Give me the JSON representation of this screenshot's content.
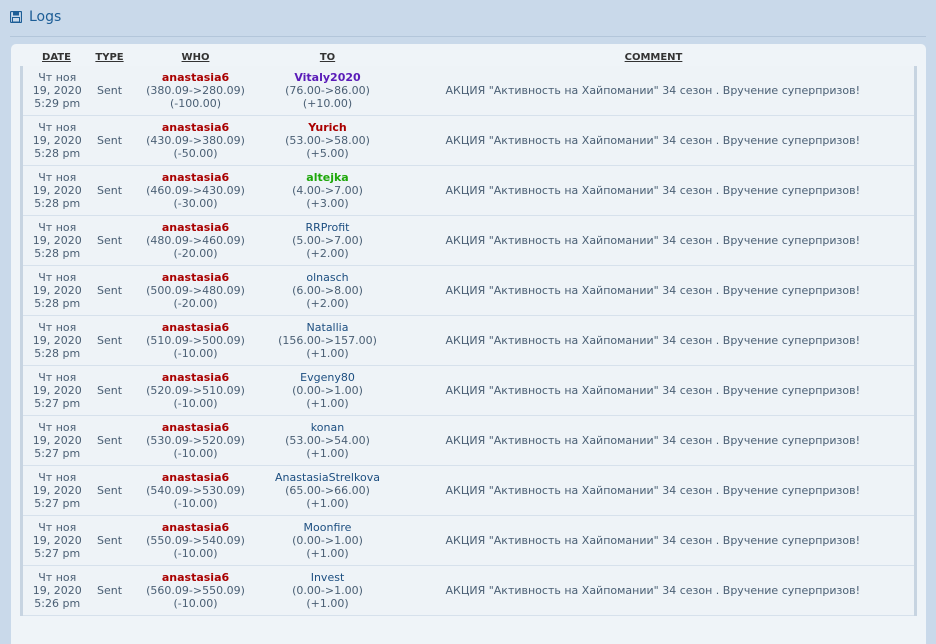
{
  "header": {
    "title": "Logs",
    "icon": "save-icon"
  },
  "table": {
    "columns": {
      "date": "DATE",
      "type": "TYPE",
      "who": "WHO",
      "to": "TO",
      "comment": "COMMENT"
    },
    "rows": [
      {
        "date1": "Чт ноя",
        "date2": "19, 2020",
        "date3": "5:29 pm",
        "type": "Sent",
        "who": "anastasia6",
        "who_balance": "(380.09->280.09)",
        "who_delta": "(-100.00)",
        "to": "Vitaly2020",
        "to_color": "#5a1bb8",
        "to_bold": true,
        "to_balance": "(76.00->86.00)",
        "to_delta": "(+10.00)",
        "comment": "АКЦИЯ \"Активность на Хайпомании\" 34 сезон . Вручение суперпризов!"
      },
      {
        "date1": "Чт ноя",
        "date2": "19, 2020",
        "date3": "5:28 pm",
        "type": "Sent",
        "who": "anastasia6",
        "who_balance": "(430.09->380.09)",
        "who_delta": "(-50.00)",
        "to": "Yurich",
        "to_color": "#aa0000",
        "to_bold": true,
        "to_balance": "(53.00->58.00)",
        "to_delta": "(+5.00)",
        "comment": "АКЦИЯ \"Активность на Хайпомании\" 34 сезон . Вручение суперпризов!"
      },
      {
        "date1": "Чт ноя",
        "date2": "19, 2020",
        "date3": "5:28 pm",
        "type": "Sent",
        "who": "anastasia6",
        "who_balance": "(460.09->430.09)",
        "who_delta": "(-30.00)",
        "to": "altejka",
        "to_color": "#1ea80a",
        "to_bold": true,
        "to_balance": "(4.00->7.00)",
        "to_delta": "(+3.00)",
        "comment": "АКЦИЯ \"Активность на Хайпомании\" 34 сезон . Вручение суперпризов!"
      },
      {
        "date1": "Чт ноя",
        "date2": "19, 2020",
        "date3": "5:28 pm",
        "type": "Sent",
        "who": "anastasia6",
        "who_balance": "(480.09->460.09)",
        "who_delta": "(-20.00)",
        "to": "RRProfit",
        "to_color": "#1c4e80",
        "to_bold": false,
        "to_balance": "(5.00->7.00)",
        "to_delta": "(+2.00)",
        "comment": "АКЦИЯ \"Активность на Хайпомании\" 34 сезон . Вручение суперпризов!"
      },
      {
        "date1": "Чт ноя",
        "date2": "19, 2020",
        "date3": "5:28 pm",
        "type": "Sent",
        "who": "anastasia6",
        "who_balance": "(500.09->480.09)",
        "who_delta": "(-20.00)",
        "to": "olnasch",
        "to_color": "#1c4e80",
        "to_bold": false,
        "to_balance": "(6.00->8.00)",
        "to_delta": "(+2.00)",
        "comment": "АКЦИЯ \"Активность на Хайпомании\" 34 сезон . Вручение суперпризов!"
      },
      {
        "date1": "Чт ноя",
        "date2": "19, 2020",
        "date3": "5:28 pm",
        "type": "Sent",
        "who": "anastasia6",
        "who_balance": "(510.09->500.09)",
        "who_delta": "(-10.00)",
        "to": "Natallia",
        "to_color": "#1c4e80",
        "to_bold": false,
        "to_balance": "(156.00->157.00)",
        "to_delta": "(+1.00)",
        "comment": "АКЦИЯ \"Активность на Хайпомании\" 34 сезон . Вручение суперпризов!"
      },
      {
        "date1": "Чт ноя",
        "date2": "19, 2020",
        "date3": "5:27 pm",
        "type": "Sent",
        "who": "anastasia6",
        "who_balance": "(520.09->510.09)",
        "who_delta": "(-10.00)",
        "to": "Evgeny80",
        "to_color": "#1c4e80",
        "to_bold": false,
        "to_balance": "(0.00->1.00)",
        "to_delta": "(+1.00)",
        "comment": "АКЦИЯ \"Активность на Хайпомании\" 34 сезон . Вручение суперпризов!"
      },
      {
        "date1": "Чт ноя",
        "date2": "19, 2020",
        "date3": "5:27 pm",
        "type": "Sent",
        "who": "anastasia6",
        "who_balance": "(530.09->520.09)",
        "who_delta": "(-10.00)",
        "to": "konan",
        "to_color": "#1c4e80",
        "to_bold": false,
        "to_balance": "(53.00->54.00)",
        "to_delta": "(+1.00)",
        "comment": "АКЦИЯ \"Активность на Хайпомании\" 34 сезон . Вручение суперпризов!"
      },
      {
        "date1": "Чт ноя",
        "date2": "19, 2020",
        "date3": "5:27 pm",
        "type": "Sent",
        "who": "anastasia6",
        "who_balance": "(540.09->530.09)",
        "who_delta": "(-10.00)",
        "to": "AnastasiaStrelkova",
        "to_color": "#1c4e80",
        "to_bold": false,
        "to_balance": "(65.00->66.00)",
        "to_delta": "(+1.00)",
        "comment": "АКЦИЯ \"Активность на Хайпомании\" 34 сезон . Вручение суперпризов!"
      },
      {
        "date1": "Чт ноя",
        "date2": "19, 2020",
        "date3": "5:27 pm",
        "type": "Sent",
        "who": "anastasia6",
        "who_balance": "(550.09->540.09)",
        "who_delta": "(-10.00)",
        "to": "Moonfire",
        "to_color": "#1c4e80",
        "to_bold": false,
        "to_balance": "(0.00->1.00)",
        "to_delta": "(+1.00)",
        "comment": "АКЦИЯ \"Активность на Хайпомании\" 34 сезон . Вручение суперпризов!"
      },
      {
        "date1": "Чт ноя",
        "date2": "19, 2020",
        "date3": "5:26 pm",
        "type": "Sent",
        "who": "anastasia6",
        "who_balance": "(560.09->550.09)",
        "who_delta": "(-10.00)",
        "to": "Invest",
        "to_color": "#1c4e80",
        "to_bold": false,
        "to_balance": "(0.00->1.00)",
        "to_delta": "(+1.00)",
        "comment": "АКЦИЯ \"Активность на Хайпомании\" 34 сезон . Вручение суперпризов!"
      }
    ]
  }
}
